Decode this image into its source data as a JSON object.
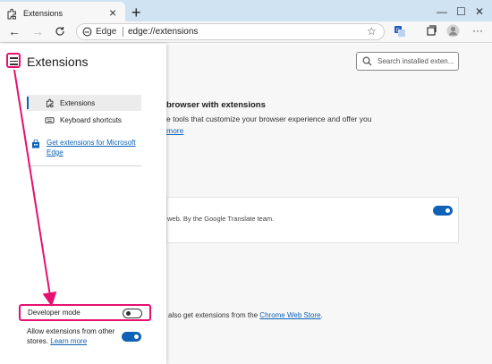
{
  "browser": {
    "tab_title": "Extensions",
    "new_tab_glyph": "+",
    "brand": "Edge",
    "url": "edge://extensions",
    "window_controls": [
      "—",
      "☐",
      "✕"
    ],
    "icons": [
      "extension-icon",
      "back-arrow-icon",
      "forward-arrow-icon",
      "refresh-icon",
      "edge-logo-icon",
      "star-icon",
      "translate-icon",
      "collections-icon",
      "profile-icon",
      "more-icon"
    ]
  },
  "panel": {
    "title": "Extensions",
    "nav": [
      {
        "label": "Extensions",
        "icon": "extension-icon",
        "active": true
      },
      {
        "label": "Keyboard shortcuts",
        "icon": "keyboard-icon",
        "active": false
      }
    ],
    "get_extensions": "Get extensions for Microsoft Edge",
    "developer_mode": {
      "label": "Developer mode",
      "on": false
    },
    "allow_other_stores": {
      "label": "Allow extensions from other stores.",
      "link": "Learn more",
      "on": true
    }
  },
  "main": {
    "search_placeholder": "Search installed exten...",
    "headline": "browser with extensions",
    "intro": "e tools that customize your browser experience and offer you",
    "intro_more": "more",
    "card": {
      "description": "web. By the Google Translate team.",
      "enabled": true
    },
    "store_text": "also get extensions from the",
    "store_link": "Chrome Web Store",
    "store_suffix": "."
  },
  "annotation": {
    "color": "#e6106f"
  }
}
